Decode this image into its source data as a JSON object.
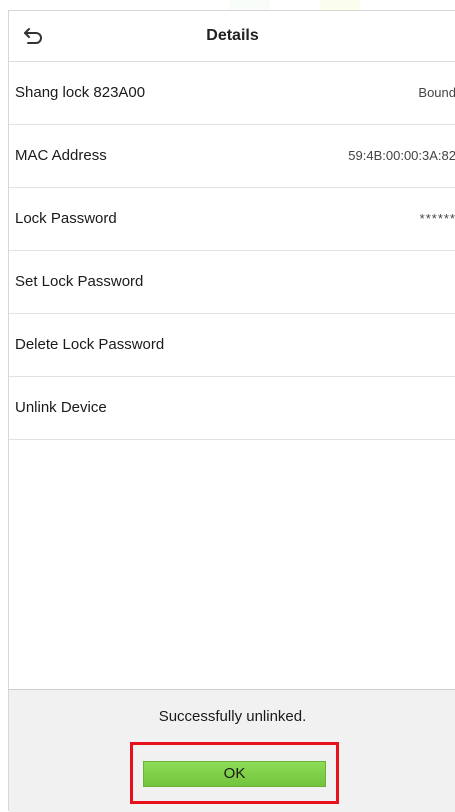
{
  "header": {
    "title": "Details",
    "back_icon": "back-arrow-icon"
  },
  "rows": [
    {
      "label": "Shang lock 823A00",
      "value": "Bound"
    },
    {
      "label": "MAC Address",
      "value": "59:4B:00:00:3A:82"
    },
    {
      "label": "Lock Password",
      "value": "******"
    },
    {
      "label": "Set Lock Password",
      "value": ""
    },
    {
      "label": "Delete Lock Password",
      "value": ""
    },
    {
      "label": "Unlink Device",
      "value": ""
    }
  ],
  "dialog": {
    "message": "Successfully unlinked.",
    "ok_label": "OK",
    "highlight_color": "#e8101a",
    "button_color": "#7ccc44"
  }
}
